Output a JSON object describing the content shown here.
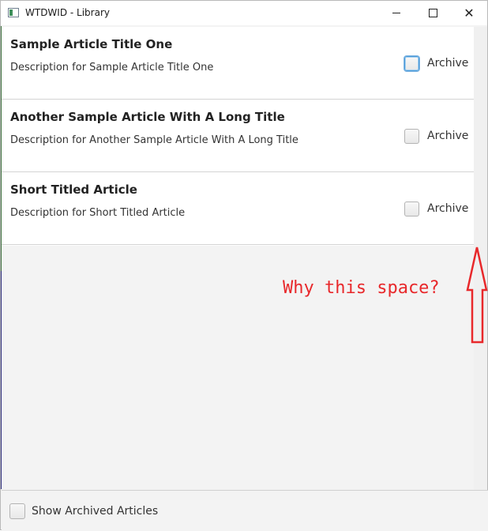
{
  "window": {
    "title": "WTDWID - Library",
    "minimize_icon": "minimize-icon",
    "maximize_icon": "maximize-icon",
    "close_glyph": "✕"
  },
  "articles": [
    {
      "title": "Sample Article Title One",
      "description": "Description for Sample Article Title One",
      "archive_label": "Archive",
      "archived": false,
      "focused": true
    },
    {
      "title": "Another Sample Article With A Long Title",
      "description": "Description for Another Sample Article With A Long Title",
      "archive_label": "Archive",
      "archived": false,
      "focused": false
    },
    {
      "title": "Short Titled Article",
      "description": "Description for Short Titled Article",
      "archive_label": "Archive",
      "archived": false,
      "focused": false
    }
  ],
  "annotation": {
    "text": "Why this space?",
    "color": "#e8282b"
  },
  "footer": {
    "show_archived_label": "Show Archived Articles",
    "checked": false
  }
}
